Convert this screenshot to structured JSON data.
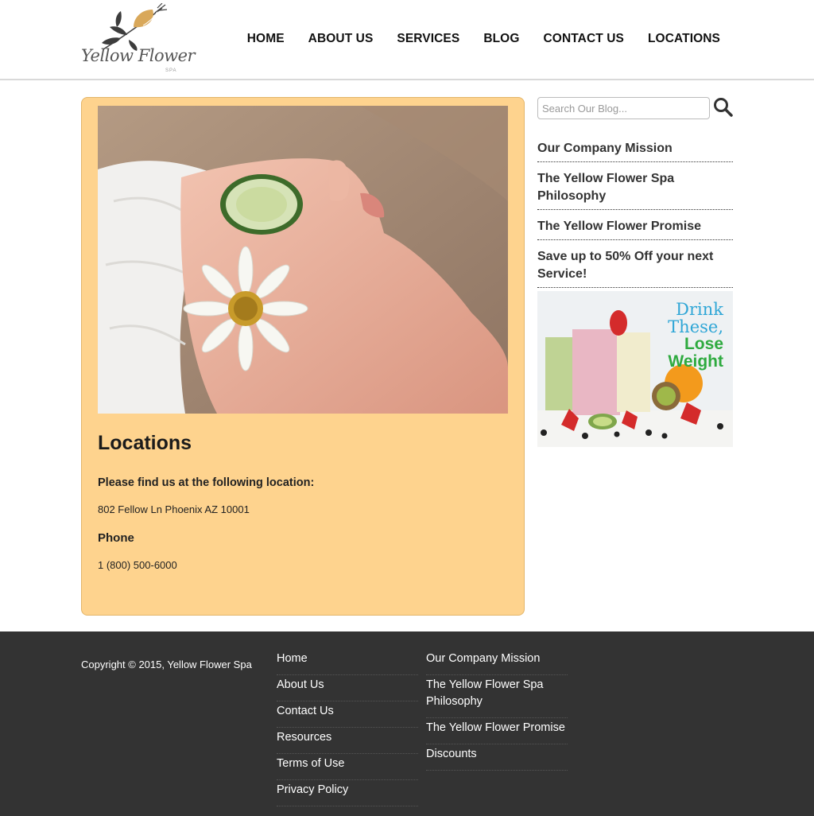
{
  "brand": {
    "logo_script": "Yellow Flower",
    "logo_small": "SPA"
  },
  "nav": [
    {
      "label": "HOME"
    },
    {
      "label": "ABOUT US"
    },
    {
      "label": "SERVICES"
    },
    {
      "label": "BLOG"
    },
    {
      "label": "CONTACT US"
    },
    {
      "label": "LOCATIONS"
    }
  ],
  "main": {
    "title": "Locations",
    "location_heading": "Please find us at the following location:",
    "address": "802 Fellow Ln Phoenix AZ 10001",
    "phone_heading": "Phone",
    "phone": "1 (800) 500-6000"
  },
  "sidebar": {
    "search_placeholder": "Search Our Blog...",
    "links": [
      {
        "label": "Our Company Mission"
      },
      {
        "label": "The Yellow Flower Spa Philosophy"
      },
      {
        "label": "The Yellow Flower Promise"
      },
      {
        "label": "Save up to 50% Off your next Service!"
      }
    ],
    "promo": {
      "line1": "Drink",
      "line2": "These,",
      "line3": "Lose",
      "line4": "Weight"
    }
  },
  "footer": {
    "copyright": "Copyright © 2015, Yellow Flower Spa",
    "col1": [
      {
        "label": "Home"
      },
      {
        "label": "About Us"
      },
      {
        "label": "Contact Us"
      },
      {
        "label": "Resources"
      },
      {
        "label": "Terms of Use"
      },
      {
        "label": "Privacy Policy"
      }
    ],
    "col2": [
      {
        "label": "Our Company Mission"
      },
      {
        "label": "The Yellow Flower Spa Philosophy"
      },
      {
        "label": "The Yellow Flower Promise"
      },
      {
        "label": "Discounts"
      }
    ]
  },
  "colors": {
    "card_bg": "#fed38e",
    "footer_bg": "#333333",
    "promo_blue": "#2fa6d6",
    "promo_green": "#2eaa3f"
  }
}
